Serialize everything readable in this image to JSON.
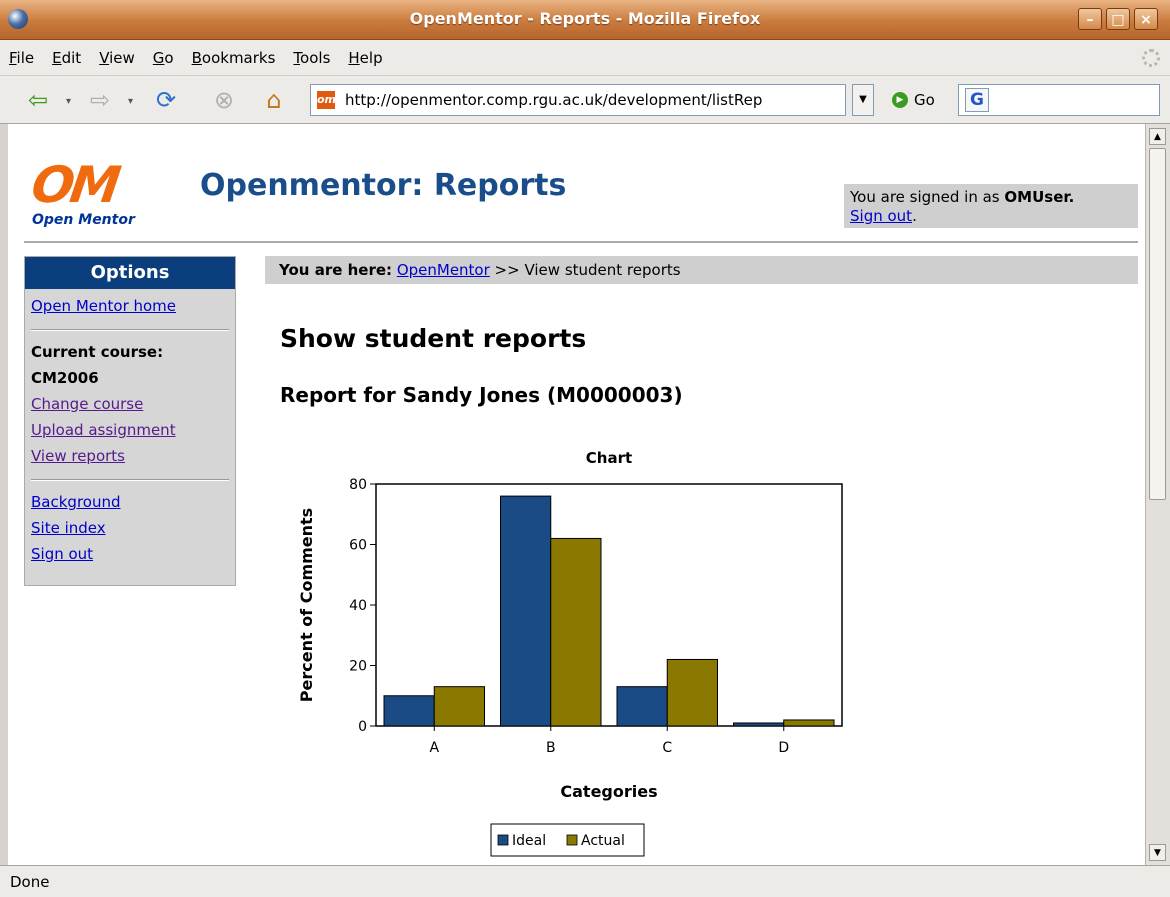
{
  "window": {
    "title": "OpenMentor - Reports - Mozilla Firefox"
  },
  "menu": [
    "File",
    "Edit",
    "View",
    "Go",
    "Bookmarks",
    "Tools",
    "Help"
  ],
  "toolbar": {
    "url": "http://openmentor.comp.rgu.ac.uk/development/listRep",
    "go_label": "Go",
    "search_logo": "G"
  },
  "status": "Done",
  "page": {
    "logo_text": "Open Mentor",
    "title": "Openmentor: Reports",
    "signin_prefix": "You are signed in as ",
    "signin_user": "OMUser.",
    "signout_link": "Sign out",
    "signin_suffix": ".",
    "breadcrumb": {
      "label": "You are here:",
      "link": "OpenMentor",
      "rest": " >> View student reports"
    },
    "heading": "Show student reports",
    "subheading": "Report for Sandy Jones (M0000003)"
  },
  "sidebar": {
    "title": "Options",
    "home": "Open Mentor home",
    "current_label": "Current course:",
    "current_course": "CM2006",
    "change": "Change course",
    "upload": "Upload assignment",
    "view": "View reports",
    "background": "Background",
    "site_index": "Site index",
    "sign_out": "Sign out"
  },
  "chart_data": {
    "type": "bar",
    "title": "Chart",
    "xlabel": "Categories",
    "ylabel": "Percent of Comments",
    "categories": [
      "A",
      "B",
      "C",
      "D"
    ],
    "series": [
      {
        "name": "Ideal",
        "values": [
          10,
          76,
          13,
          1
        ],
        "color": "#1b4b85"
      },
      {
        "name": "Actual",
        "values": [
          13,
          62,
          22,
          2
        ],
        "color": "#8a7800"
      }
    ],
    "ylim": [
      0,
      80
    ],
    "yticks": [
      0,
      20,
      40,
      60,
      80
    ],
    "grid": false,
    "legend": "bottom"
  }
}
